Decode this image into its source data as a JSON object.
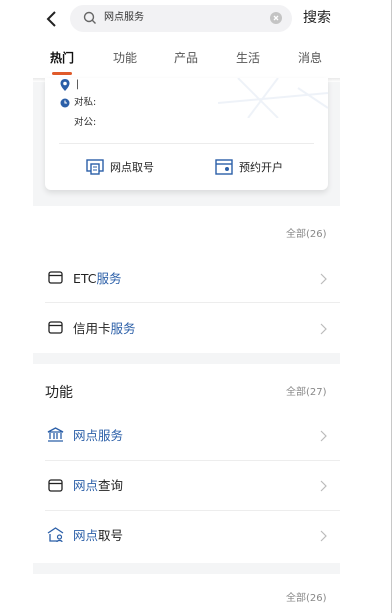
{
  "search": {
    "query": "网点服务",
    "button_label": "搜索"
  },
  "tabs": [
    {
      "label": "热门",
      "active": true
    },
    {
      "label": "功能",
      "active": false
    },
    {
      "label": "产品",
      "active": false
    },
    {
      "label": "生活",
      "active": false
    },
    {
      "label": "消息",
      "active": false
    }
  ],
  "branch_card": {
    "address": "|",
    "personal_label": "对私:",
    "corporate_label": "对公:",
    "action_queue": "网点取号",
    "action_account": "预约开户"
  },
  "section1": {
    "count": "全部(26)",
    "items": [
      {
        "prefix": "ETC",
        "highlight": "服务",
        "icon": "card-icon"
      },
      {
        "prefix": "信用卡",
        "highlight": "服务",
        "icon": "card-icon"
      }
    ]
  },
  "section2": {
    "title": "功能",
    "count": "全部(27)",
    "items": [
      {
        "highlight": "网点服务",
        "rest": "",
        "icon": "bank-icon"
      },
      {
        "highlight": "网点",
        "rest": "查询",
        "icon": "card-icon"
      },
      {
        "highlight": "网点",
        "rest": "取号",
        "icon": "bank-person-icon"
      }
    ]
  },
  "section3": {
    "count": "全部(26)"
  },
  "colors": {
    "accent": "#2b5fa8",
    "tab_indicator": "#e05a2a"
  }
}
